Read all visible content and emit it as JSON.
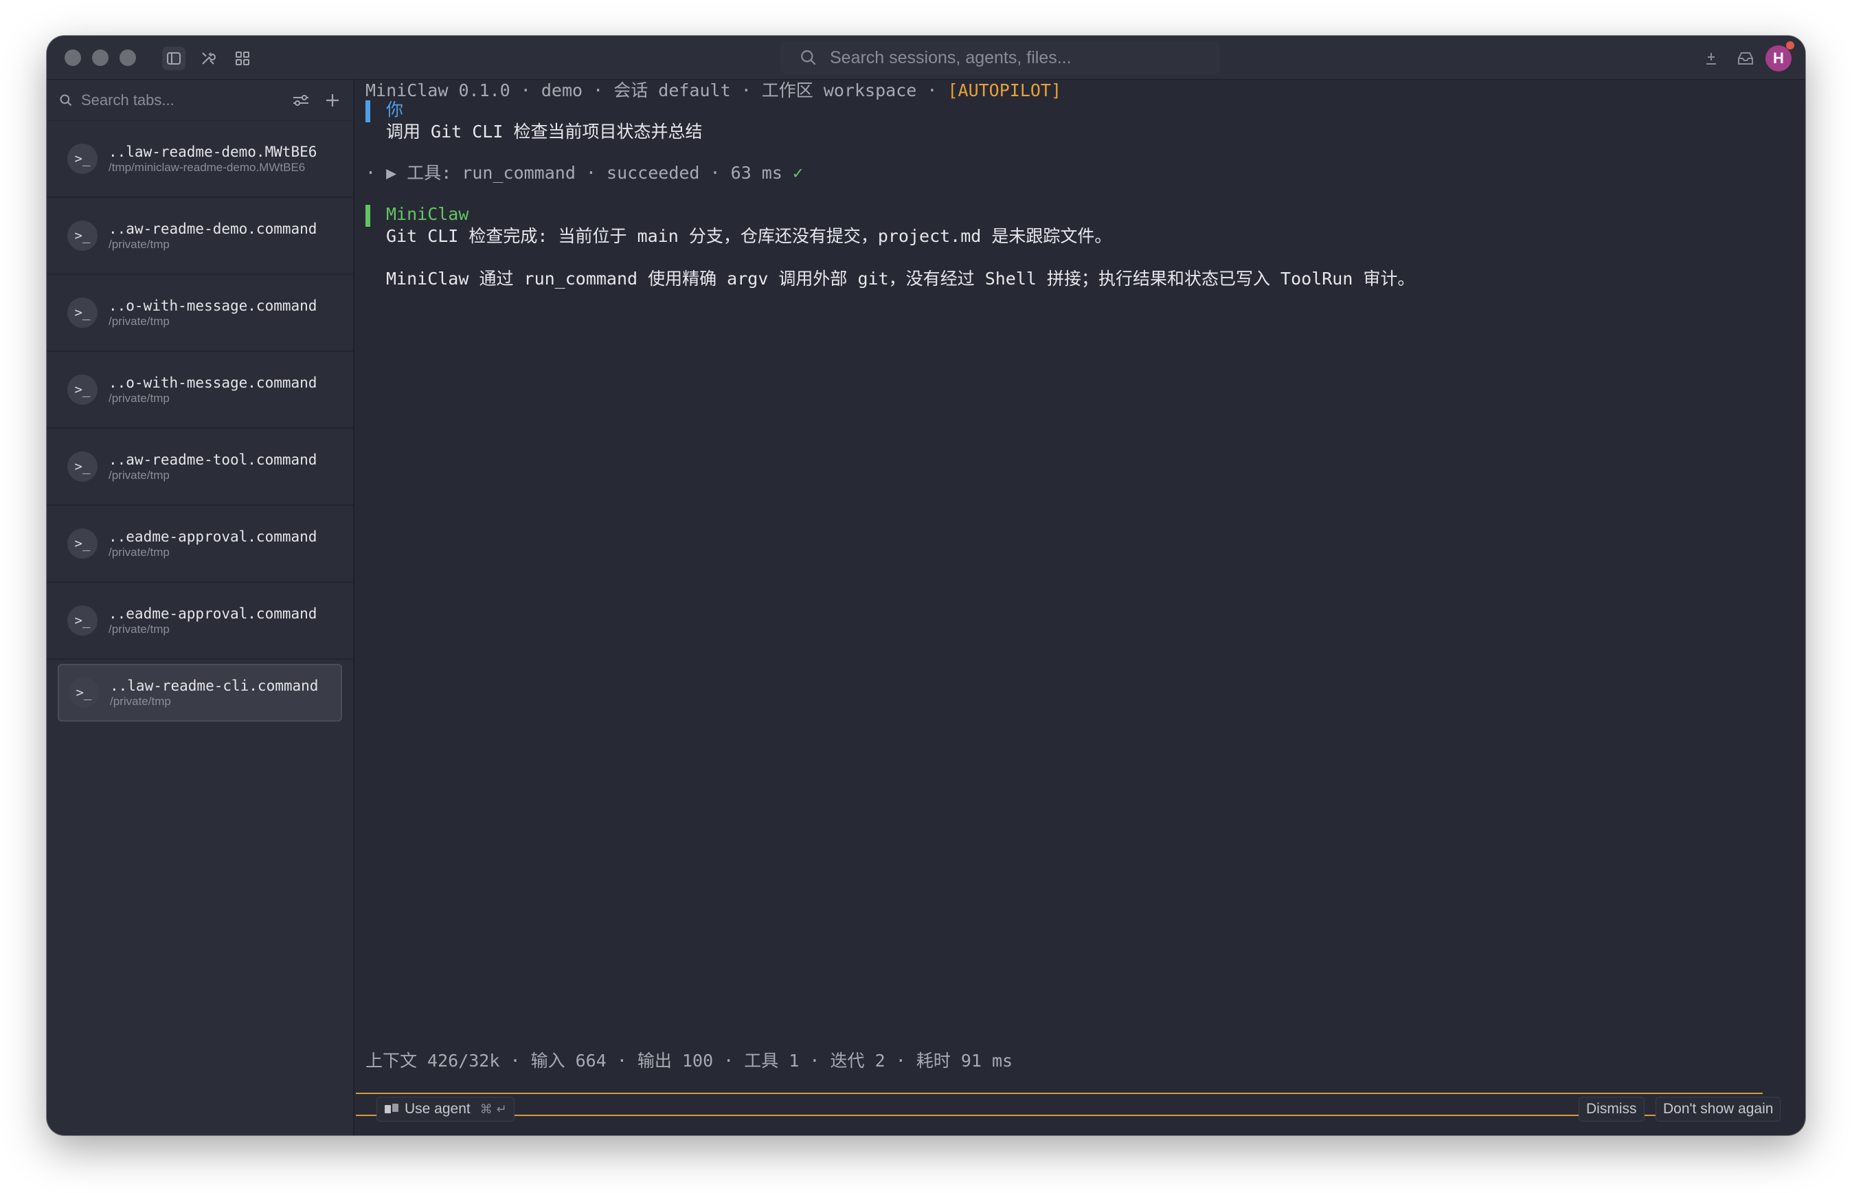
{
  "titlebar": {
    "search_placeholder": "Search sessions, agents, files...",
    "avatar_initial": "H"
  },
  "sidebar": {
    "search_placeholder": "Search tabs...",
    "tabs": [
      {
        "title": "..law-readme-demo.MWtBE6",
        "path": "/tmp/miniclaw-readme-demo.MWtBE6"
      },
      {
        "title": "..aw-readme-demo.command",
        "path": "/private/tmp"
      },
      {
        "title": "..o-with-message.command",
        "path": "/private/tmp"
      },
      {
        "title": "..o-with-message.command",
        "path": "/private/tmp"
      },
      {
        "title": "..aw-readme-tool.command",
        "path": "/private/tmp"
      },
      {
        "title": "..eadme-approval.command",
        "path": "/private/tmp"
      },
      {
        "title": "..eadme-approval.command",
        "path": "/private/tmp"
      },
      {
        "title": "..law-readme-cli.command",
        "path": "/private/tmp"
      }
    ],
    "term_glyph": ">_"
  },
  "terminal": {
    "header_main": "MiniClaw 0.1.0 · demo · 会话 default · 工作区 workspace · ",
    "header_mode": "[AUTOPILOT]",
    "user_label": "你",
    "user_message": "调用 Git CLI 检查当前项目状态并总结",
    "tool_line": "· ▶ 工具: run_command · succeeded · 63 ms ",
    "tool_check": "✓",
    "agent_label": "MiniClaw",
    "agent_line1": "Git CLI 检查完成: 当前位于 main 分支，仓库还没有提交，project.md 是未跟踪文件。",
    "agent_line2": "MiniClaw 通过 run_command 使用精确 argv 调用外部 git，没有经过 Shell 拼接；执行结果和状态已写入 ToolRun 审计。",
    "stats": "上下文 426/32k · 输入 664 · 输出 100 · 工具 1 · 迭代 2 · 耗时 91 ms"
  },
  "footer": {
    "use_agent": "Use agent",
    "use_agent_keys": "⌘ ↵",
    "dismiss": "Dismiss",
    "dont_show": "Don't show again"
  },
  "colors": {
    "accent_gold": "#e8a13a",
    "user_blue": "#4f9fe8",
    "agent_green": "#63c464"
  }
}
